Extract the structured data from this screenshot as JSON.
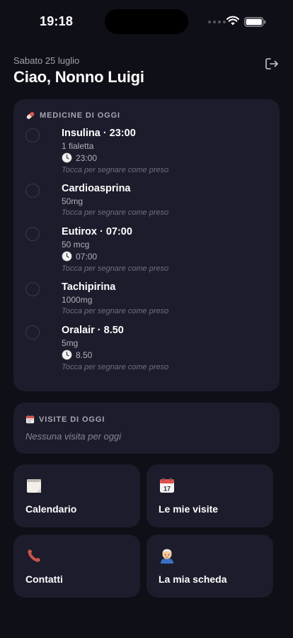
{
  "status": {
    "time": "19:18"
  },
  "header": {
    "date": "Sabato 25 luglio",
    "greeting": "Ciao, Nonno Luigi"
  },
  "medicines": {
    "title": "MEDICINE DI OGGI",
    "icon": "pill",
    "items": [
      {
        "name": "Insulina · 23:00",
        "dose": "1 fialetta",
        "time": "23:00",
        "hint": "Tocca per segnare come preso"
      },
      {
        "name": "Cardioasprina",
        "dose": "50mg",
        "time": null,
        "hint": "Tocca per segnare come preso"
      },
      {
        "name": "Eutirox · 07:00",
        "dose": "50 mcg",
        "time": "07:00",
        "hint": "Tocca per segnare come preso"
      },
      {
        "name": "Tachipirina",
        "dose": "1000mg",
        "time": null,
        "hint": "Tocca per segnare come preso"
      },
      {
        "name": "Oralair · 8.50",
        "dose": "5mg",
        "time": "8.50",
        "hint": "Tocca per segnare come preso"
      }
    ]
  },
  "visits": {
    "title": "VISITE DI OGGI",
    "icon": "calendar",
    "empty": "Nessuna visita per oggi"
  },
  "tiles": [
    {
      "label": "Calendario",
      "icon": "notepad"
    },
    {
      "label": "Le mie visite",
      "icon": "calendar"
    },
    {
      "label": "Contatti",
      "icon": "phone"
    },
    {
      "label": "La mia scheda",
      "icon": "elderly-man"
    }
  ],
  "colors": {
    "background": "#0f0f17",
    "card": "#1c1c2c",
    "text": "#ffffff",
    "muted": "#a6a6b4"
  }
}
